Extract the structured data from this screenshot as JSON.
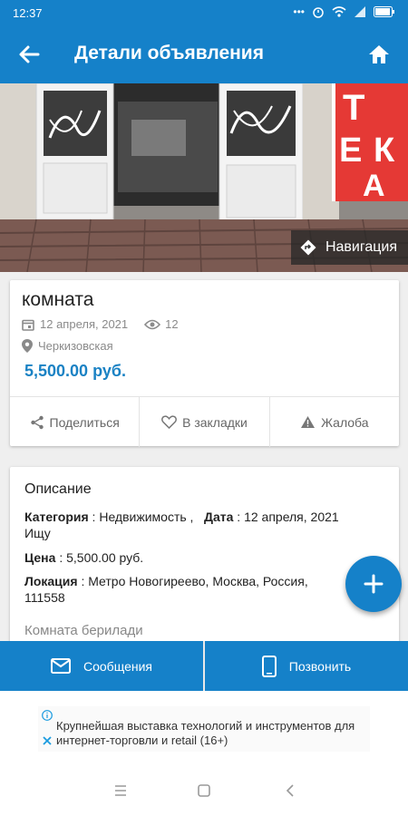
{
  "status": {
    "time": "12:37"
  },
  "appbar": {
    "title": "Детали объявления"
  },
  "hero": {
    "navigation_label": "Навигация"
  },
  "listing": {
    "title": "комната",
    "date": "12 апреля, 2021",
    "views": "12",
    "location": "Черкизовская",
    "price": "5,500.00 руб."
  },
  "actions": {
    "share": "Поделиться",
    "bookmark": "В закладки",
    "report": "Жалоба"
  },
  "description": {
    "header": "Описание",
    "category_label": "Категория",
    "category_value": " : Недвижимость , Ищу",
    "date_label": "Дата",
    "date_value": " : 12 апреля, 2021",
    "price_label": "Цена",
    "price_value": " : 5,500.00 руб.",
    "location_label": "Локация",
    "location_value": " : Метро Новогиреево, Москва, Россия, 111558",
    "text": "Комната берилади"
  },
  "bottom": {
    "messages": "Сообщения",
    "call": "Позвонить"
  },
  "ad": {
    "text": "Крупнейшая выставка технологий и инструментов для интернет-торговли и retail (16+)"
  },
  "colors": {
    "primary": "#1581c9",
    "price": "#1a82c4",
    "background": "#efefef"
  },
  "icons": [
    "back-arrow-icon",
    "home-icon",
    "navigation-icon",
    "calendar-icon",
    "eye-icon",
    "location-pin-icon",
    "share-icon",
    "heart-icon",
    "warning-icon",
    "plus-icon",
    "mail-icon",
    "phone-icon",
    "info-icon",
    "close-icon"
  ]
}
